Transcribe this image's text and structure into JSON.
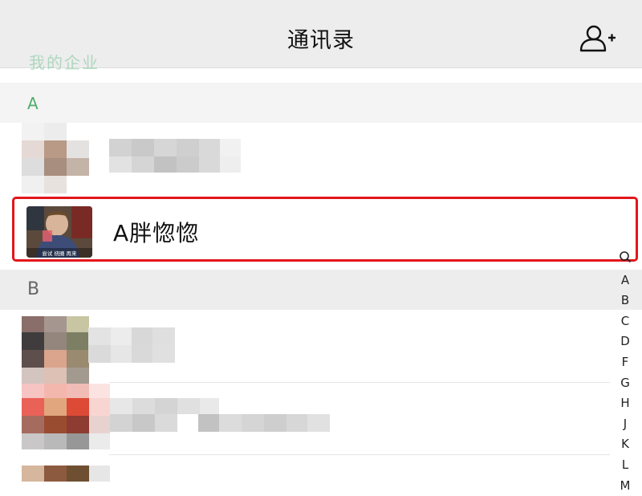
{
  "navbar": {
    "title": "通讯录",
    "add_icon": "add-friend-icon"
  },
  "ghost_header": "我的企业",
  "sections": [
    {
      "letter": "A"
    },
    {
      "letter": "B"
    }
  ],
  "highlight_contact": {
    "name": "A胖惚惚",
    "avatar_caption": "尝试 绕圈 再来"
  },
  "index_bar": [
    "Q",
    "A",
    "B",
    "C",
    "D",
    "F",
    "G",
    "H",
    "J",
    "K",
    "L",
    "M"
  ],
  "colors": {
    "highlight_border": "#e3161b",
    "section_letter": "#57be6a",
    "nav_bg": "#ededed"
  }
}
